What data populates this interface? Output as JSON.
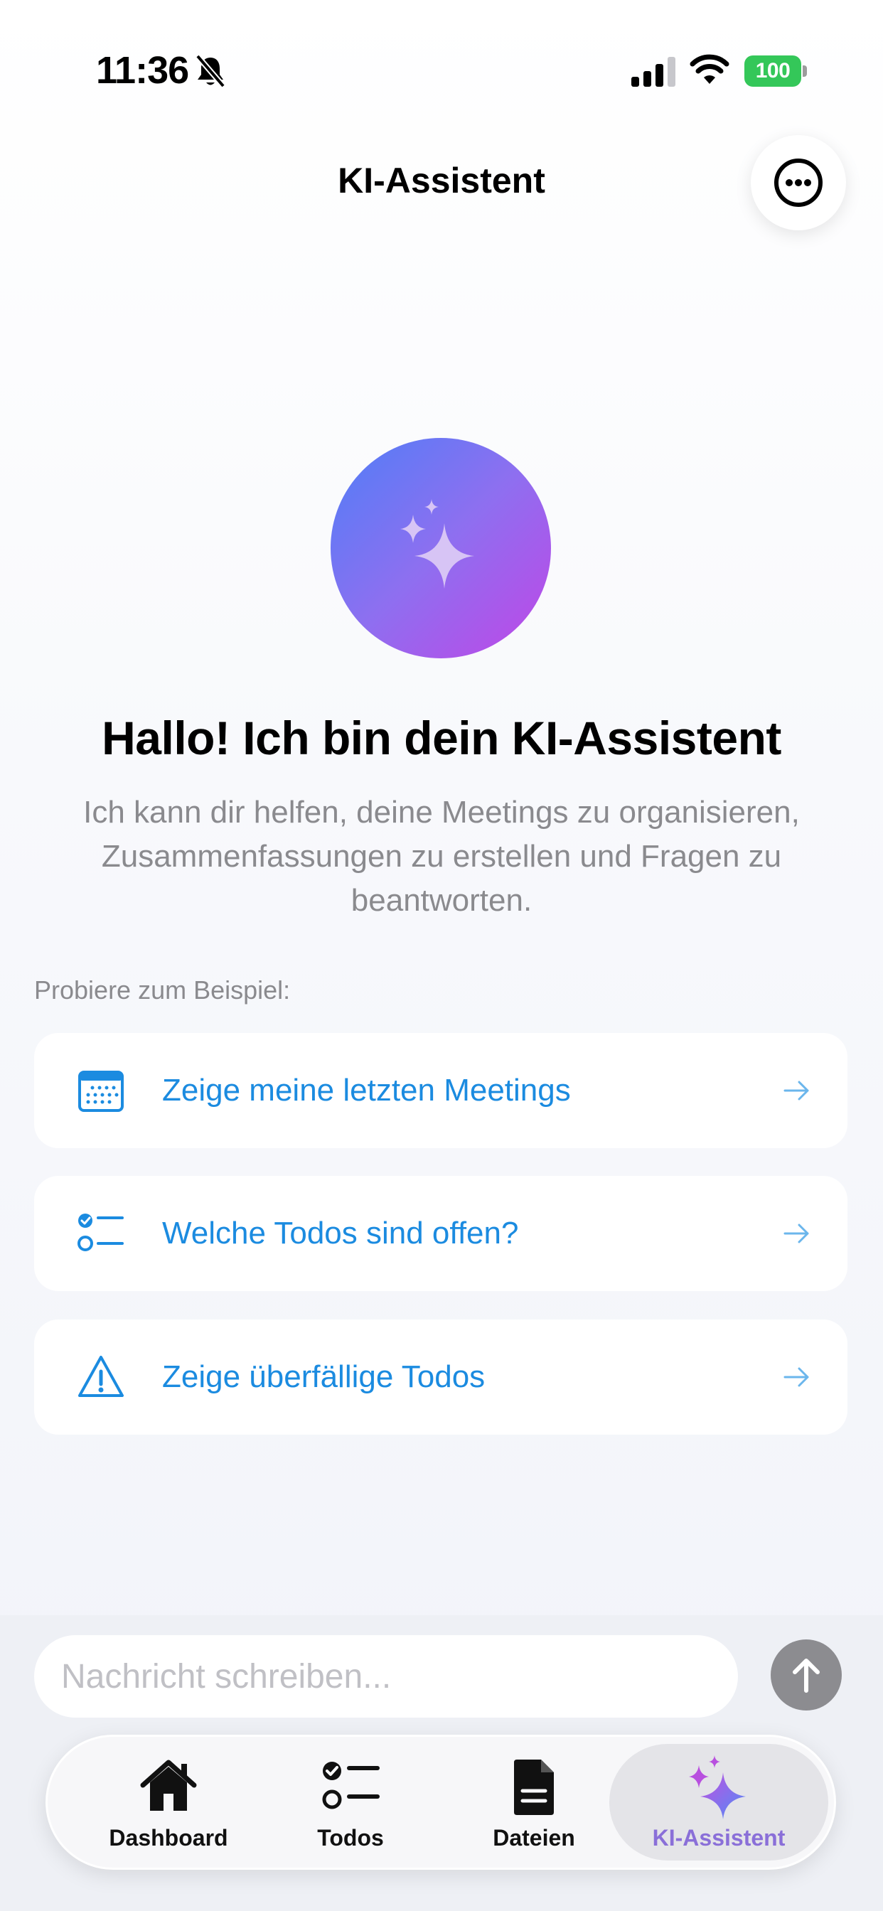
{
  "status_bar": {
    "time": "11:36",
    "battery": "100",
    "icons": [
      "bell-slash-icon",
      "cellular-signal-icon",
      "wifi-icon",
      "battery-icon"
    ]
  },
  "header": {
    "title": "KI-Assistent",
    "more_icon": "ellipsis-circle-icon"
  },
  "hero": {
    "icon": "sparkles-icon",
    "title": "Hallo! Ich bin dein KI-Assistent",
    "subtitle": "Ich kann dir helfen, deine Meetings zu organisieren, Zusammenfassungen zu erstellen und Fragen zu beantworten."
  },
  "examples": {
    "label": "Probiere zum Beispiel:",
    "items": [
      {
        "label": "Zeige meine letzten Meetings",
        "icon": "calendar-icon"
      },
      {
        "label": "Welche Todos sind offen?",
        "icon": "checklist-icon"
      },
      {
        "label": "Zeige überfällige Todos",
        "icon": "warning-triangle-icon"
      }
    ]
  },
  "composer": {
    "placeholder": "Nachricht schreiben...",
    "send_icon": "arrow-up-icon"
  },
  "tab_bar": {
    "items": [
      {
        "label": "Dashboard",
        "icon": "house-icon"
      },
      {
        "label": "Todos",
        "icon": "checklist-icon"
      },
      {
        "label": "Dateien",
        "icon": "document-icon"
      },
      {
        "label": "KI-Assistent",
        "icon": "sparkles-icon",
        "active": true
      }
    ]
  },
  "colors": {
    "accent_blue": "#1b8be0",
    "active_tab": "#8a6fd8",
    "battery_green": "#34c759",
    "gradient_start": "#4f7ef7",
    "gradient_end": "#c046e6"
  }
}
